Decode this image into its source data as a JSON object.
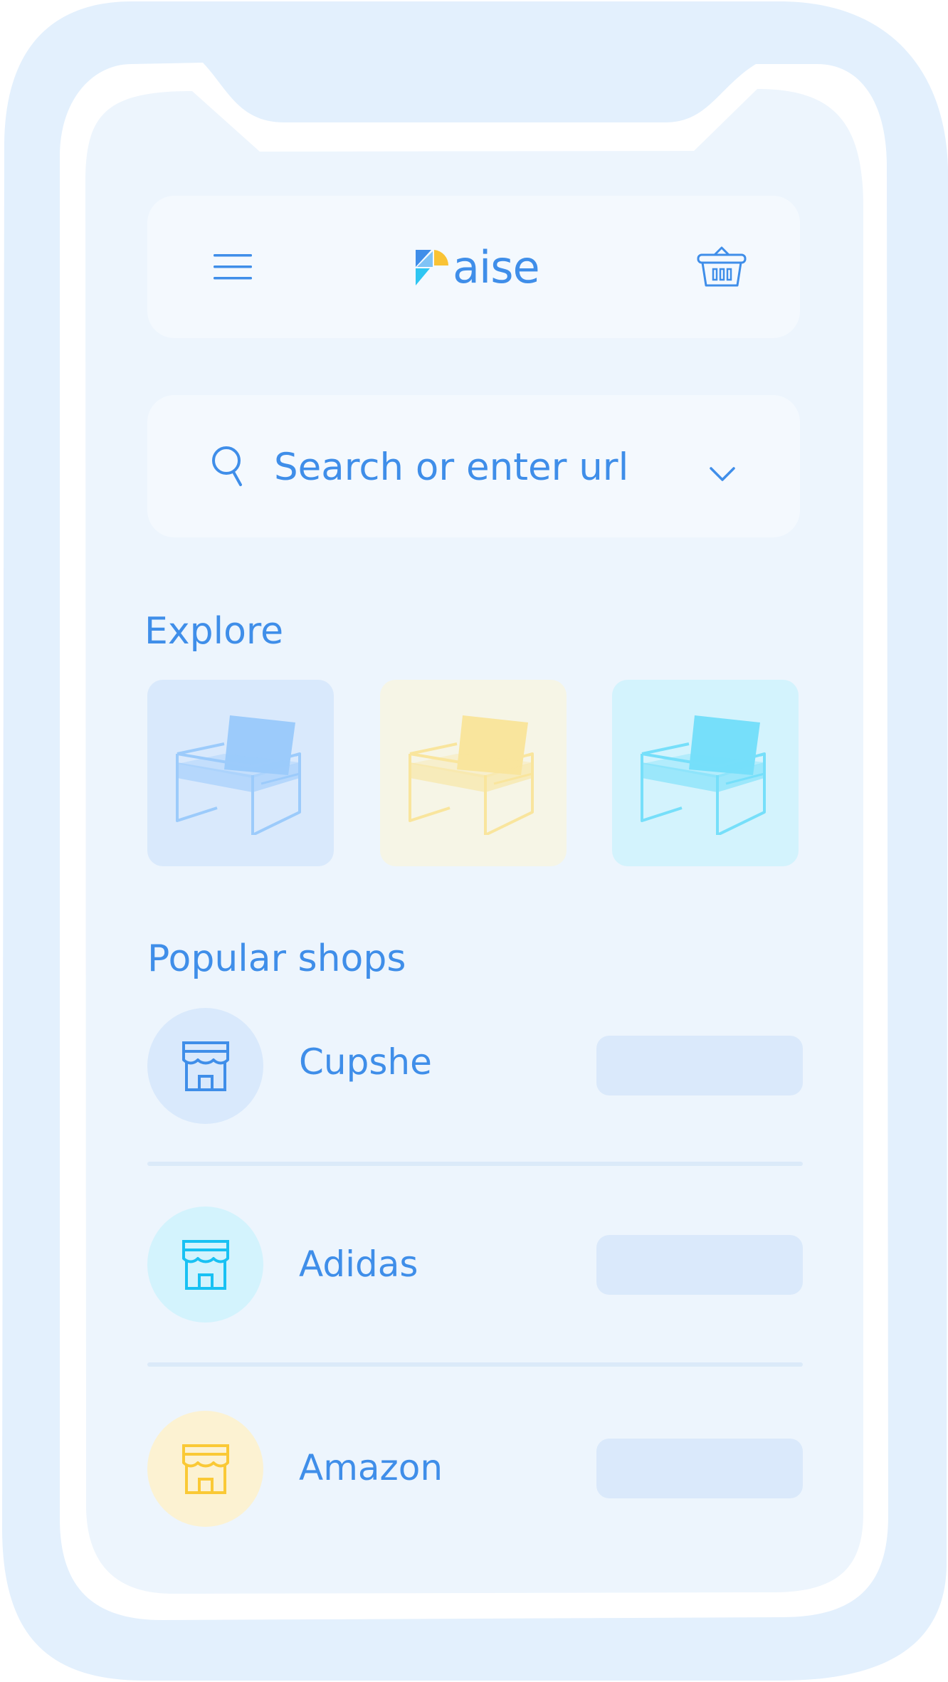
{
  "colors": {
    "accent": "#3f8ee9",
    "frame": "#e3f0fd",
    "screen": "#edf5fd",
    "card": "#f4f9fe",
    "logo_yellow": "#f9c335",
    "logo_cyan": "#2fc6f2"
  },
  "header": {
    "menu_icon": "hamburger-menu-icon",
    "logo_text": "aise",
    "basket_icon": "shopping-basket-icon"
  },
  "search": {
    "icon": "search-icon",
    "placeholder": "Search or enter url",
    "dropdown_icon": "chevron-down-icon"
  },
  "explore": {
    "title": "Explore",
    "items": [
      {
        "icon": "armchair-icon",
        "bg": "#d9e9fc",
        "seat": "#9ccbfb",
        "frame": "#9ccbfb"
      },
      {
        "icon": "armchair-icon",
        "bg": "#f6f5e6",
        "seat": "#f9e59d",
        "frame": "#f9e59d"
      },
      {
        "icon": "armchair-icon",
        "bg": "#d3f3fd",
        "seat": "#76dffa",
        "frame": "#76dffa"
      }
    ]
  },
  "popular": {
    "title": "Popular shops",
    "shops": [
      {
        "name": "Cupshe",
        "icon": "storefront-icon",
        "circle": "#d9e9fc",
        "color": "#3f8ee9"
      },
      {
        "name": "Adidas",
        "icon": "storefront-icon",
        "circle": "#d3f3fd",
        "color": "#18c1f3"
      },
      {
        "name": "Amazon",
        "icon": "storefront-icon",
        "circle": "#fcf2d2",
        "color": "#fac935"
      }
    ]
  }
}
